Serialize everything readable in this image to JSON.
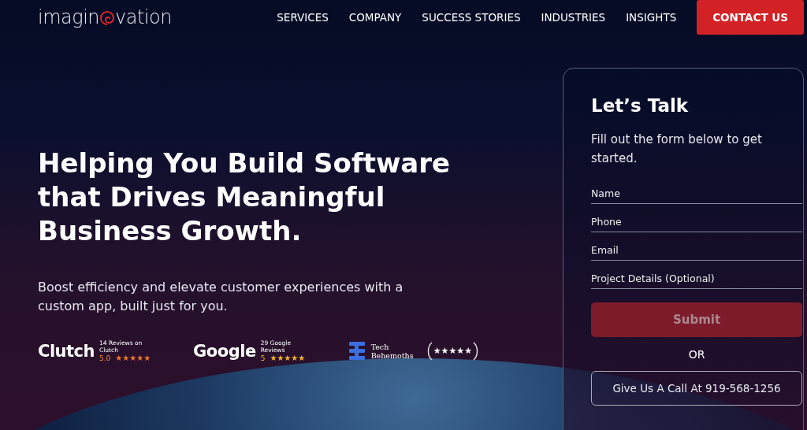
{
  "header": {
    "logo": {
      "before": "imagin",
      "after": "vation"
    },
    "nav": [
      {
        "label": "SERVICES"
      },
      {
        "label": "COMPANY"
      },
      {
        "label": "SUCCESS STORIES"
      },
      {
        "label": "INDUSTRIES"
      },
      {
        "label": "INSIGHTS"
      }
    ],
    "cta": "CONTACT US"
  },
  "hero": {
    "title": "Helping You Build Software that Drives Meaningful Business Growth.",
    "subtitle": "Boost efficiency and elevate customer experiences with a custom app, built just for you.",
    "ratings": [
      {
        "kind": "score",
        "brand": "Clutch",
        "caption": "14 Reviews on Clutch",
        "score": "5.0",
        "stars": 5
      },
      {
        "kind": "score",
        "brand": "Google",
        "caption": "29 Google Reviews",
        "score": "5",
        "stars": 5
      },
      {
        "kind": "laurel",
        "brand": "Tech Behemoths",
        "stars": 5
      }
    ]
  },
  "form": {
    "title": "Let’s Talk",
    "intro": "Fill out the form below to get started.",
    "fields": [
      {
        "placeholder": "Name"
      },
      {
        "placeholder": "Phone"
      },
      {
        "placeholder": "Email"
      },
      {
        "placeholder": "Project Details (Optional)"
      }
    ],
    "submit": {
      "label": "Submit",
      "disabled": true
    },
    "separator": "OR",
    "call_button": "Give Us A Call At 919-568-1256"
  }
}
